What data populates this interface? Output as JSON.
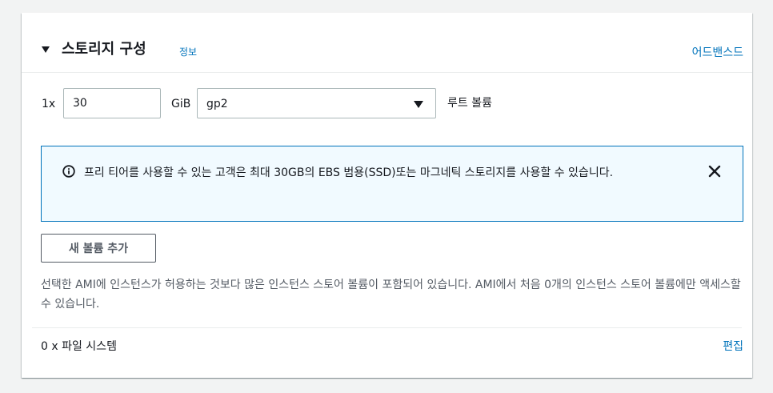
{
  "header": {
    "title": "스토리지 구성",
    "info_link": "정보",
    "advanced_link": "어드밴스드"
  },
  "volume": {
    "count_label": "1x",
    "size_value": "30",
    "unit_label": "GiB",
    "type_selected": "gp2",
    "root_label": "루트 볼륨"
  },
  "alert": {
    "text": "프리 티어를 사용할 수 있는 고객은 최대 30GB의 EBS 범용(SSD)또는 마그네틱 스토리지를 사용할 수 있습니다."
  },
  "add_volume_button": "새 볼륨 추가",
  "instance_store_note": "선택한 AMI에 인스턴스가 허용하는 것보다 많은 인스턴스 스토어 볼륨이 포함되어 있습니다. AMI에서 처음 0개의 인스턴스 스토어 볼륨에만 액세스할 수 있습니다.",
  "file_systems": {
    "label": "0 x 파일 시스템",
    "edit_link": "편집"
  },
  "colors": {
    "link": "#0073bb",
    "alert_bg": "#f1faff",
    "alert_border": "#0073bb",
    "text": "#16191f"
  }
}
